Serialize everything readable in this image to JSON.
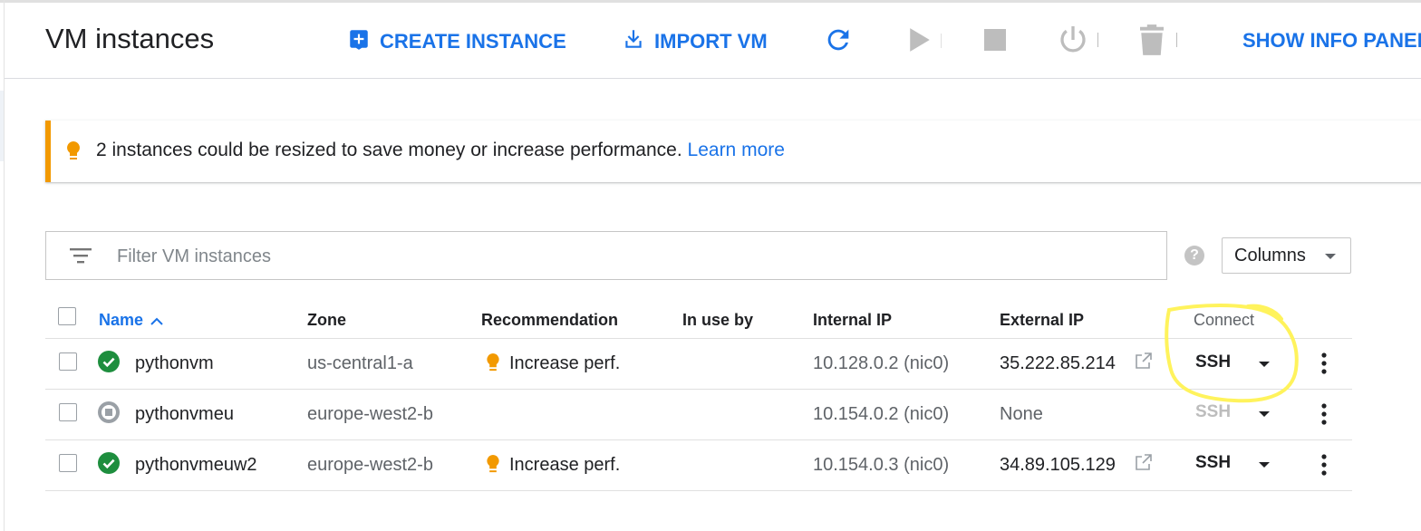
{
  "header": {
    "title": "VM instances",
    "actions": [
      {
        "label": "CREATE INSTANCE",
        "icon": "add-box-icon"
      },
      {
        "label": "IMPORT VM",
        "icon": "download-icon"
      }
    ],
    "icon_actions": [
      "refresh-icon",
      "play-icon",
      "stop-icon",
      "power-icon",
      "trash-icon"
    ],
    "info_panel_label": "SHOW INFO PANEL"
  },
  "banner": {
    "text": "2 instances could be resized to save money or increase performance.",
    "link": "Learn more",
    "accent": "#f29900"
  },
  "filter": {
    "placeholder": "Filter VM instances"
  },
  "help_label": "?",
  "columns_button": "Columns",
  "table": {
    "headers": {
      "name": "Name",
      "zone": "Zone",
      "recommendation": "Recommendation",
      "in_use_by": "In use by",
      "internal_ip": "Internal IP",
      "external_ip": "External IP",
      "connect": "Connect"
    },
    "sort": "name-ascending",
    "rows": [
      {
        "status": "running",
        "name": "pythonvm",
        "zone": "us-central1-a",
        "recommendation": "Increase perf.",
        "in_use_by": "",
        "internal_ip": "10.128.0.2 (nic0)",
        "external_ip": "35.222.85.214",
        "connect": "SSH",
        "ssh_enabled": true
      },
      {
        "status": "stopped",
        "name": "pythonvmeu",
        "zone": "europe-west2-b",
        "recommendation": "",
        "in_use_by": "",
        "internal_ip": "10.154.0.2 (nic0)",
        "external_ip": "None",
        "connect": "SSH",
        "ssh_enabled": false
      },
      {
        "status": "running",
        "name": "pythonvmeuw2",
        "zone": "europe-west2-b",
        "recommendation": "Increase perf.",
        "in_use_by": "",
        "internal_ip": "10.154.0.3 (nic0)",
        "external_ip": "34.89.105.129",
        "connect": "SSH",
        "ssh_enabled": true
      }
    ]
  },
  "colors": {
    "accent_blue": "#1a73e8",
    "running_green": "#1e8e3e",
    "stopped_grey": "#9aa0a6",
    "highlight_yellow": "#fff35c"
  }
}
